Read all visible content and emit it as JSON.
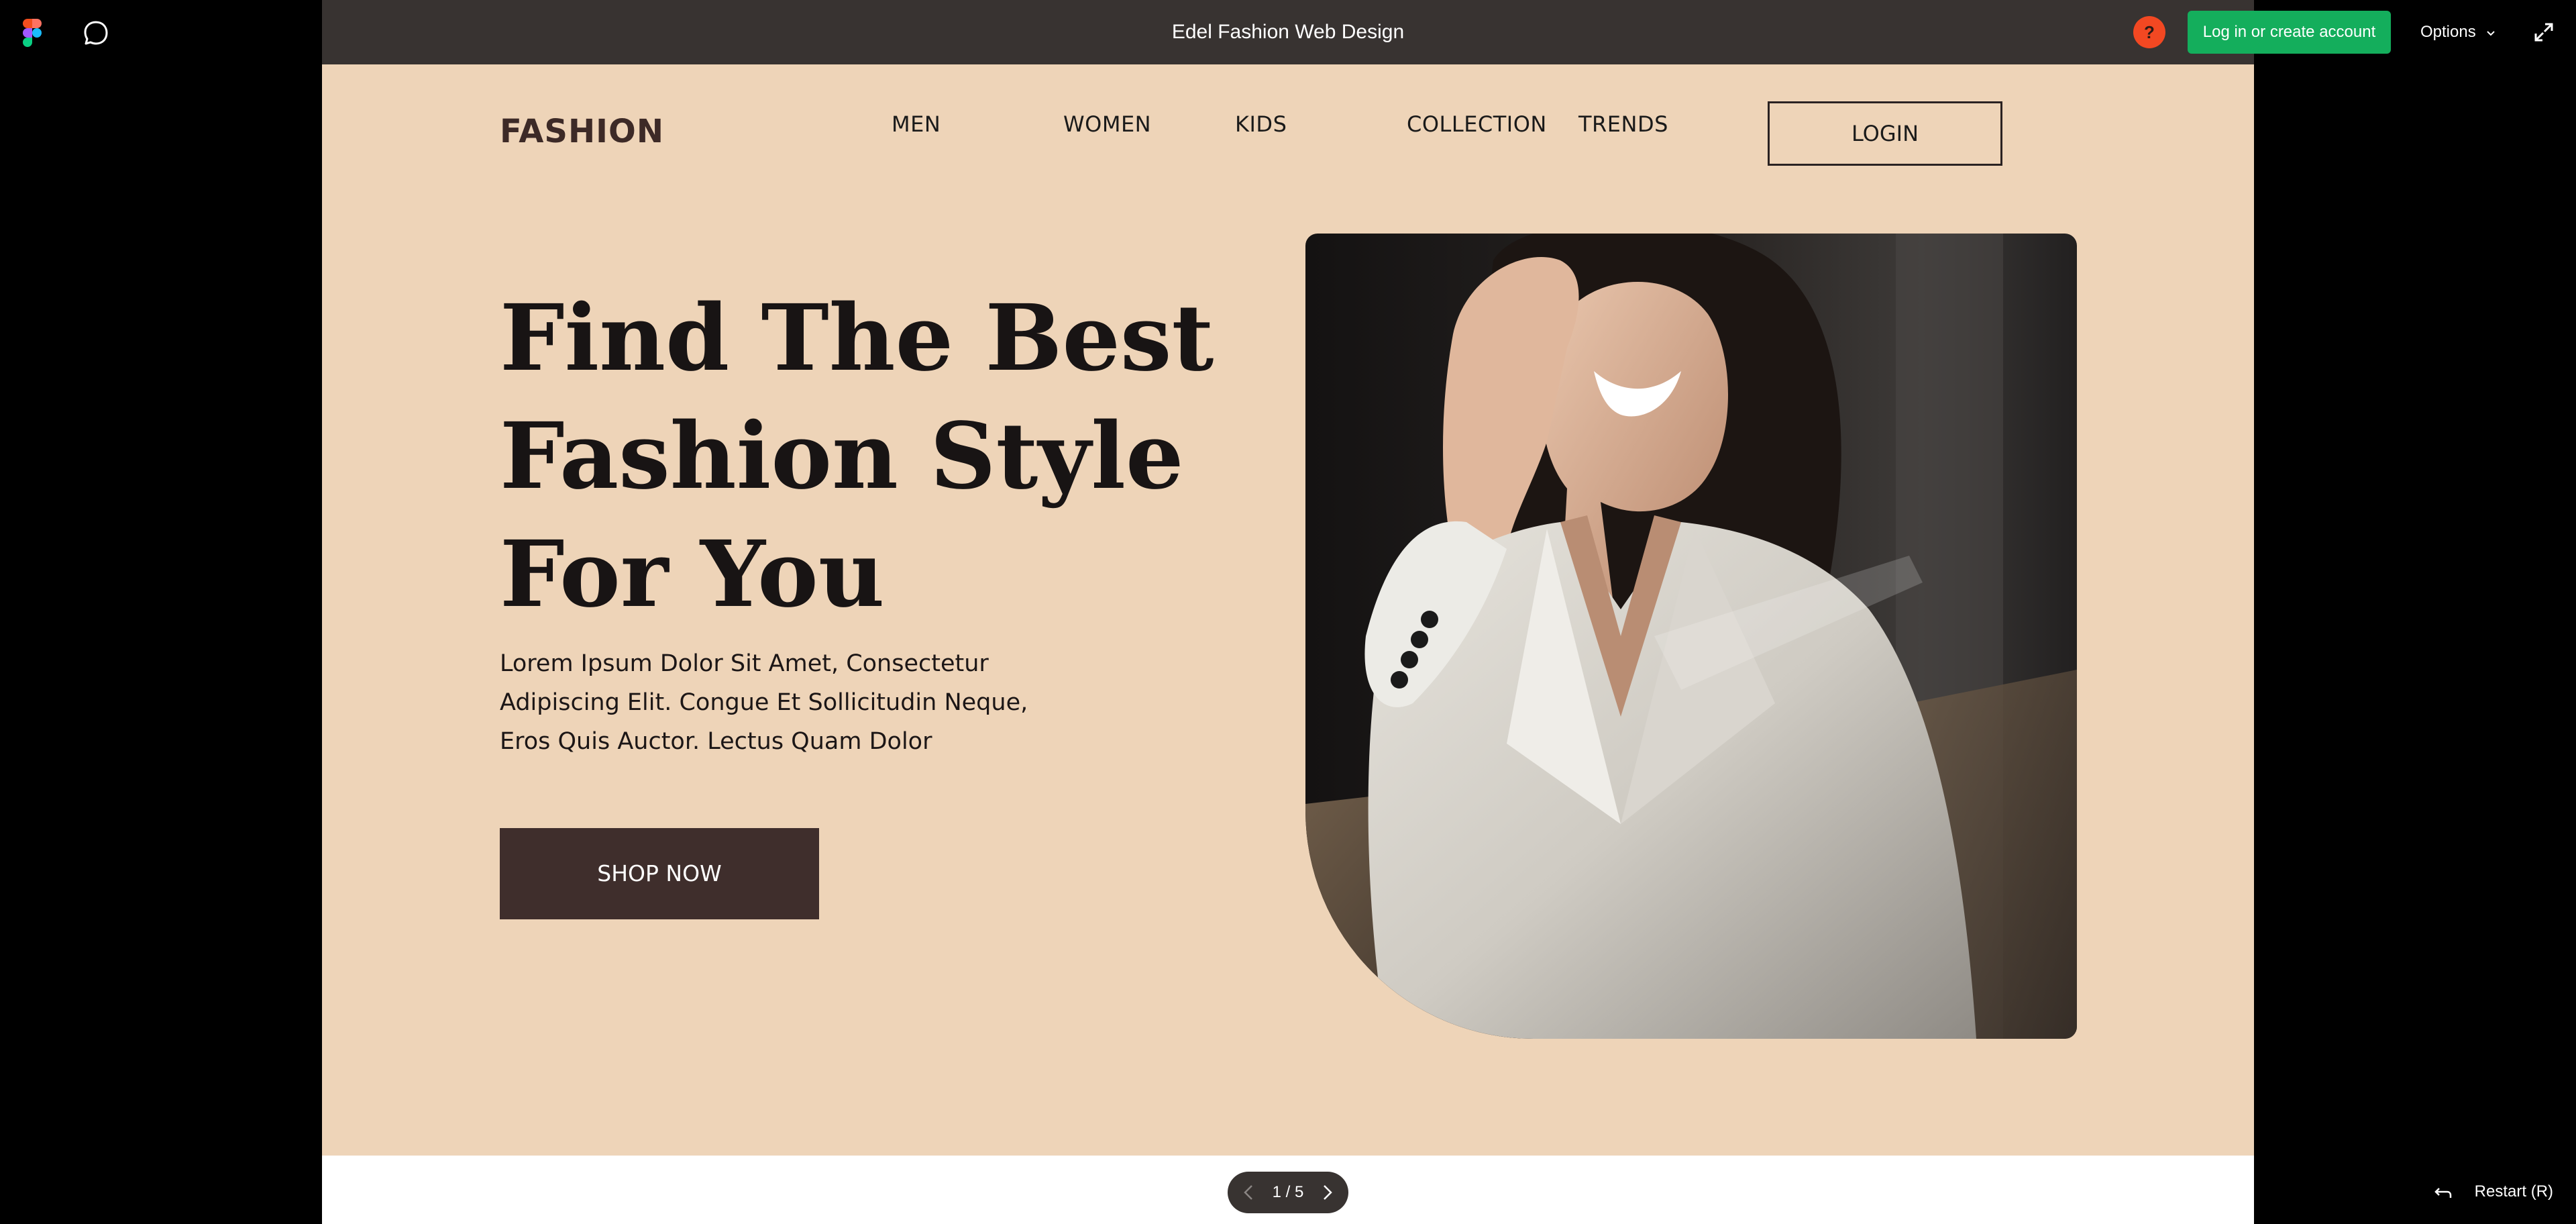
{
  "viewer": {
    "title": "Edel Fashion Web Design",
    "help_label": "?",
    "login_cta": "Log in or create account",
    "options_label": "Options",
    "icons": [
      "figma-logo-icon",
      "comment-icon",
      "chevron-down-icon",
      "expand-icon",
      "chevron-left-icon",
      "chevron-right-icon",
      "restart-icon"
    ],
    "pager": {
      "count": "1 / 5"
    },
    "restart_label": "Restart (R)"
  },
  "site": {
    "logo": "FASHION",
    "nav": [
      "MEN",
      "WOMEN",
      "KIDS",
      "COLLECTION",
      "TRENDS"
    ],
    "login_label": "LOGIN",
    "headline": [
      "Find The Best",
      "Fashion Style",
      "For You"
    ],
    "subcopy": [
      "Lorem Ipsum Dolor Sit Amet, Consectetur",
      "Adipiscing Elit. Congue Et Sollicitudin Neque,",
      "Eros Quis Auctor. Lectus Quam Dolor"
    ],
    "cta_label": "SHOP NOW"
  },
  "colors": {
    "frame_bg": "#eed4b8",
    "toolbar_bg": "#383331",
    "cta_green": "#14ae5c",
    "help_orange": "#f24822",
    "shop_button": "#3f2e2c"
  }
}
